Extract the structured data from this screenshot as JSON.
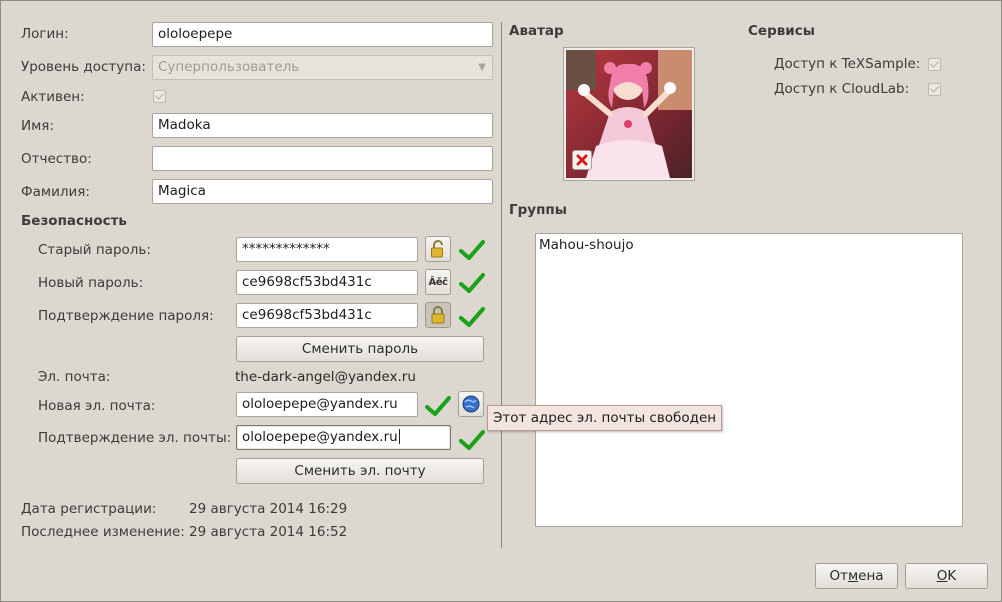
{
  "account": {
    "login_label": "Логин:",
    "login_value": "ololoepepe",
    "access_label": "Уровень доступа:",
    "access_value": "Суперпользователь",
    "active_label": "Активен:",
    "active_checked": true,
    "name_label": "Имя:",
    "name_value": "Madoka",
    "patronymic_label": "Отчество:",
    "patronymic_value": "",
    "surname_label": "Фамилия:",
    "surname_value": "Magica"
  },
  "security": {
    "heading": "Безопасность",
    "old_password_label": "Старый пароль:",
    "old_password_value": "*************",
    "new_password_label": "Новый пароль:",
    "new_password_value": "ce9698cf53bd431c",
    "confirm_password_label": "Подтверждение пароля:",
    "confirm_password_value": "ce9698cf53bd431c",
    "change_password_button": "Сменить пароль",
    "email_label": "Эл. почта:",
    "email_value": "the-dark-angel@yandex.ru",
    "new_email_label": "Новая эл. почта:",
    "new_email_value": "ololoepepe@yandex.ru",
    "confirm_email_label": "Подтверждение эл. почты:",
    "confirm_email_value": "ololoepepe@yandex.ru",
    "change_email_button": "Сменить эл. почту",
    "email_tooltip": "Этот адрес эл. почты свободен"
  },
  "dates": {
    "registration_label": "Дата регистрации:",
    "registration_value": "29 августа 2014 16:29",
    "modified_label": "Последнее изменение:",
    "modified_value": "29 августа 2014 16:52"
  },
  "avatar": {
    "heading": "Аватар"
  },
  "services": {
    "heading": "Сервисы",
    "items": [
      {
        "label": "Доступ к TeXSample:",
        "checked": true
      },
      {
        "label": "Доступ к CloudLab:",
        "checked": true
      }
    ]
  },
  "groups": {
    "heading": "Группы",
    "items": [
      "Mahou-shoujo"
    ]
  },
  "dialog": {
    "cancel_pre": "От",
    "cancel_mnemonic": "м",
    "cancel_post": "ена",
    "ok_mnemonic": "O",
    "ok_post": "K"
  },
  "colors": {
    "window_bg": "#dcd7cf",
    "check_green": "#1aa31a",
    "tooltip_bg": "#f2e5df"
  }
}
